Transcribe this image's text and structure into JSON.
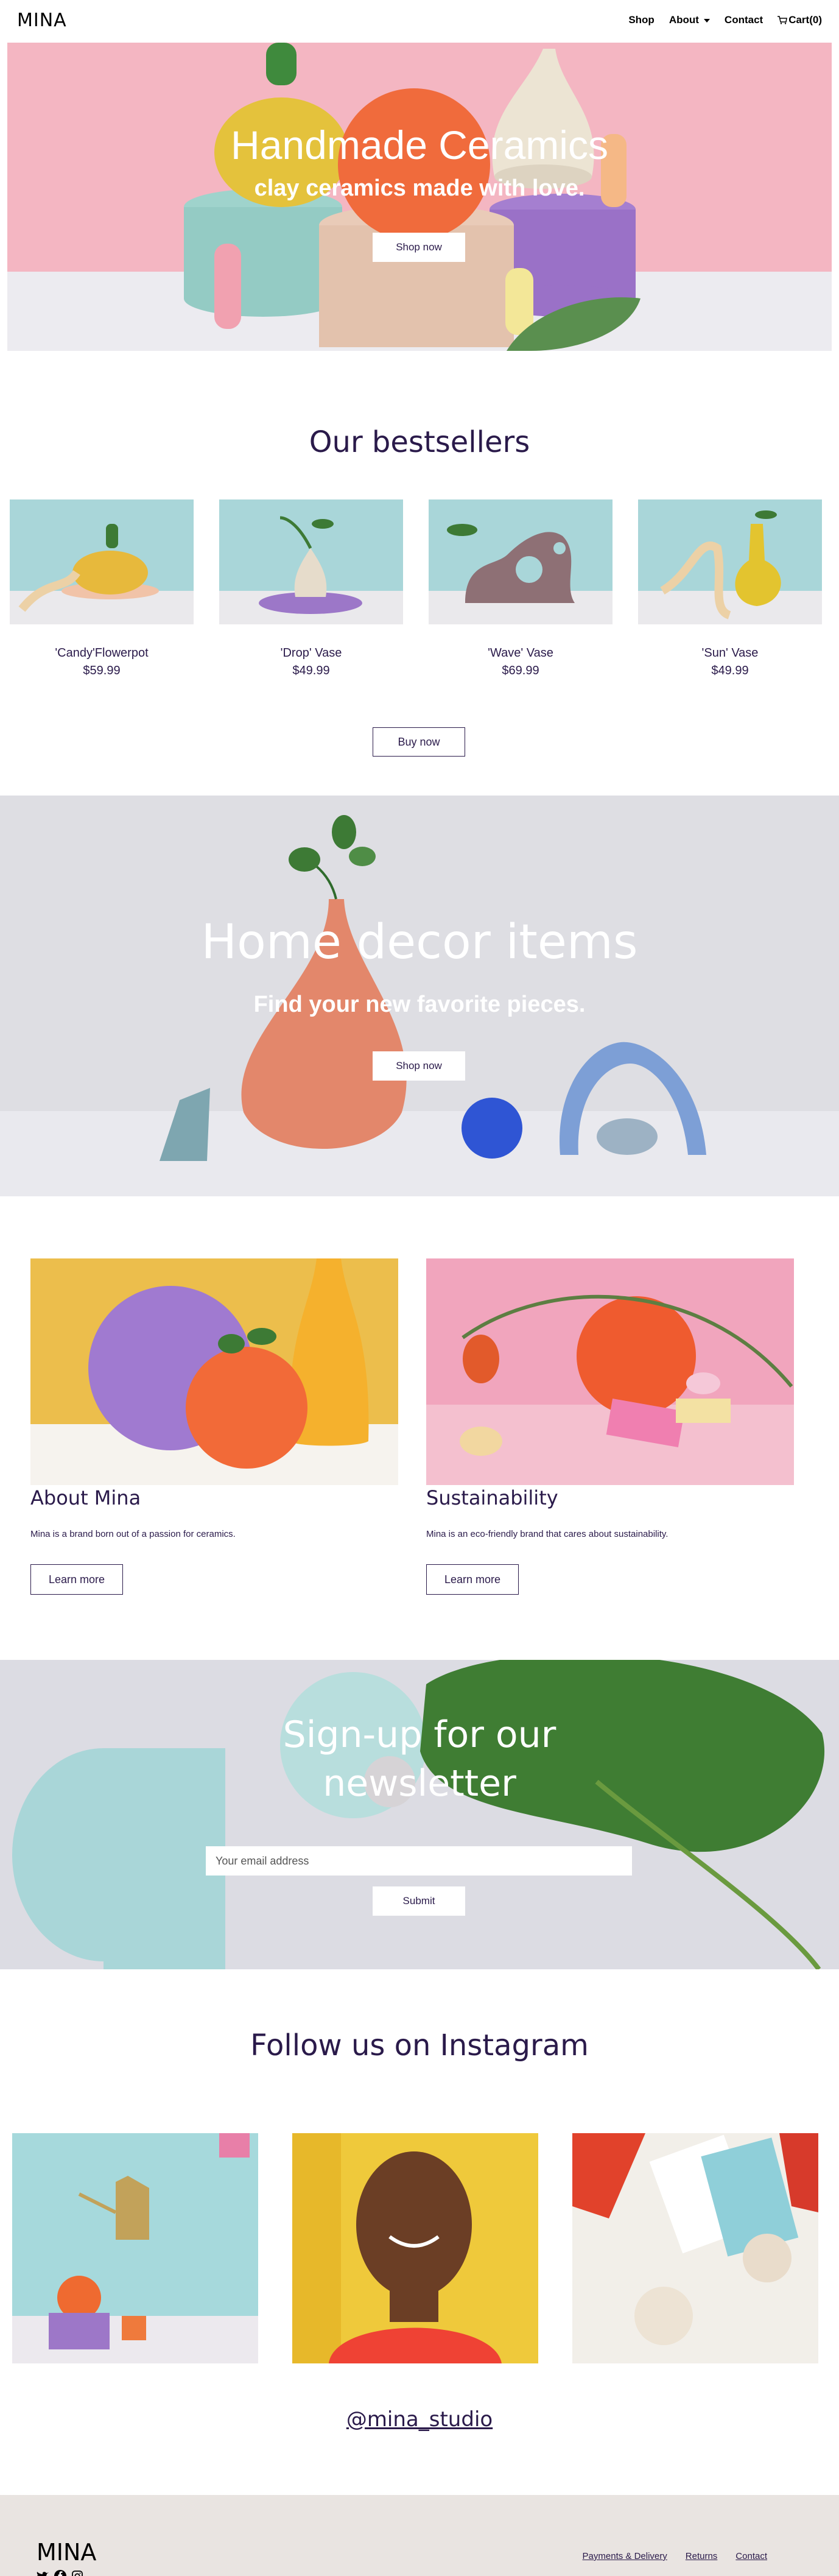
{
  "nav": {
    "logo": "MINA",
    "links": {
      "shop": "Shop",
      "about": "About",
      "contact": "Contact",
      "cart": "Cart(0)"
    }
  },
  "hero": {
    "title": "Handmade Ceramics",
    "subtitle": "clay ceramics made with love.",
    "button": "Shop now"
  },
  "bestsellers": {
    "title": "Our bestsellers",
    "products": [
      {
        "name": "'Candy'Flowerpot",
        "price": "$59.99"
      },
      {
        "name": "'Drop' Vase",
        "price": "$49.99"
      },
      {
        "name": "'Wave' Vase",
        "price": "$69.99"
      },
      {
        "name": "'Sun' Vase",
        "price": "$49.99"
      }
    ],
    "button": "Buy now"
  },
  "decor": {
    "title": "Home decor items",
    "subtitle": "Find your new favorite pieces.",
    "button": "Shop now"
  },
  "about": {
    "title": "About Mina",
    "text": "Mina is a brand born out of a passion for ceramics.",
    "button": "Learn more"
  },
  "sustainability": {
    "title": "Sustainability",
    "text": "Mina is an eco-friendly brand that cares about sustainability.",
    "button": "Learn more"
  },
  "newsletter": {
    "title_line1": "Sign-up for our",
    "title_line2": "newsletter",
    "placeholder": "Your email address",
    "button": "Submit"
  },
  "instagram": {
    "title": "Follow us on Instagram",
    "handle": "@mina_studio"
  },
  "footer": {
    "logo": "MINA",
    "links": [
      "Payments & Delivery",
      "Returns",
      "Contact"
    ]
  }
}
